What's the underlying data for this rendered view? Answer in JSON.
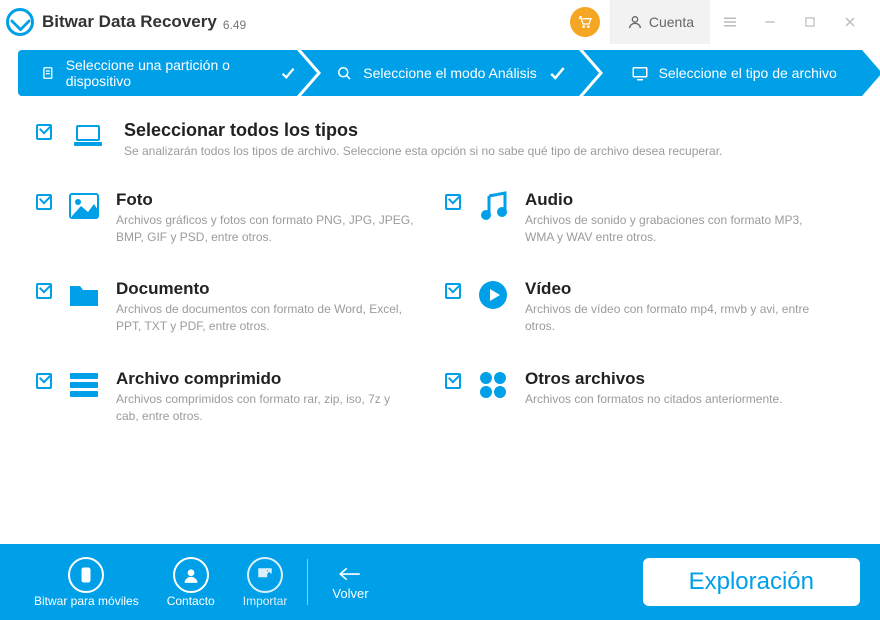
{
  "app": {
    "name": "Bitwar Data Recovery",
    "version": "6.49",
    "account_label": "Cuenta"
  },
  "wizard": {
    "step1": "Seleccione una partición o dispositivo",
    "step2": "Seleccione el modo Análisis",
    "step3": "Seleccione el tipo de archivo"
  },
  "all_types": {
    "title": "Seleccionar todos los tipos",
    "desc": "Se analizarán todos los tipos de archivo. Seleccione esta opción si no sabe qué tipo de archivo desea recuperar."
  },
  "types": {
    "photo": {
      "title": "Foto",
      "desc": "Archivos gráficos y fotos con formato PNG, JPG, JPEG, BMP, GIF y PSD, entre otros."
    },
    "audio": {
      "title": "Audio",
      "desc": "Archivos de sonido y grabaciones con formato MP3, WMA y WAV entre otros."
    },
    "document": {
      "title": "Documento",
      "desc": "Archivos de documentos con formato de Word, Excel, PPT, TXT y PDF, entre otros."
    },
    "video": {
      "title": "Vídeo",
      "desc": "Archivos de vídeo con formato mp4, rmvb y avi, entre otros."
    },
    "archive": {
      "title": "Archivo comprimido",
      "desc": "Archivos comprimidos con formato rar, zip, iso, 7z y cab, entre otros."
    },
    "other": {
      "title": "Otros archivos",
      "desc": "Archivos con formatos no citados anteriormente."
    }
  },
  "footer": {
    "mobile": "Bitwar para móviles",
    "contact": "Contacto",
    "import": "Importar",
    "back": "Volver",
    "scan": "Exploración"
  }
}
